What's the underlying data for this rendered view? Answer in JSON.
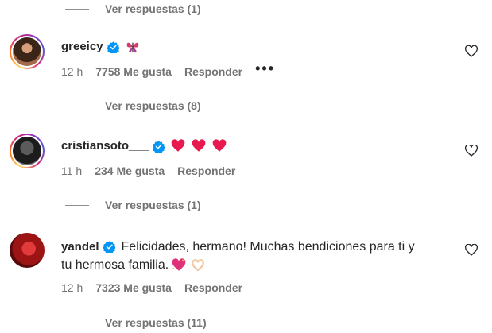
{
  "comments": [
    {
      "username": "greeicy",
      "text": "",
      "emoji": [
        "butterfly"
      ],
      "time": "12 h",
      "likes": "7758 Me gusta",
      "reply": "Responder",
      "more": "•••",
      "replies": "Ver respuestas (8)"
    },
    {
      "username": "cristiansoto___",
      "text": "",
      "emoji": [
        "red-heart",
        "red-heart",
        "red-heart"
      ],
      "time": "11 h",
      "likes": "234 Me gusta",
      "reply": "Responder",
      "replies": "Ver respuestas (1)"
    },
    {
      "username": "yandel",
      "text_line1": "Felicidades, hermano! Muchas bendiciones para ti y",
      "text_line2": "tu hermosa familia.",
      "emoji": [
        "sparkling-heart",
        "heart-hands"
      ],
      "time": "12 h",
      "likes": "7323 Me gusta",
      "reply": "Responder",
      "replies": "Ver respuestas (11)"
    }
  ],
  "top_replies": "Ver respuestas (1)",
  "colors": {
    "text": "#262626",
    "secondary": "#737373",
    "verified": "#0095f6",
    "heart": "#ff3040"
  }
}
